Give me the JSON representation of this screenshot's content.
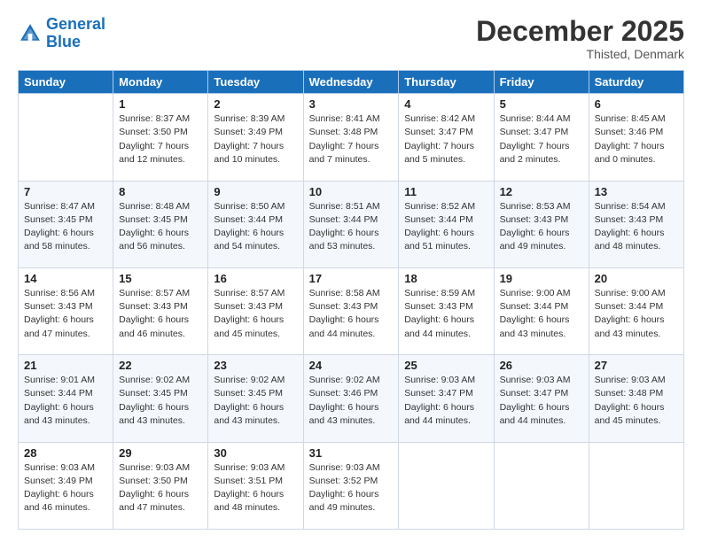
{
  "logo": {
    "line1": "General",
    "line2": "Blue"
  },
  "title": "December 2025",
  "subtitle": "Thisted, Denmark",
  "header_days": [
    "Sunday",
    "Monday",
    "Tuesday",
    "Wednesday",
    "Thursday",
    "Friday",
    "Saturday"
  ],
  "weeks": [
    [
      {
        "day": "",
        "info": ""
      },
      {
        "day": "1",
        "info": "Sunrise: 8:37 AM\nSunset: 3:50 PM\nDaylight: 7 hours\nand 12 minutes."
      },
      {
        "day": "2",
        "info": "Sunrise: 8:39 AM\nSunset: 3:49 PM\nDaylight: 7 hours\nand 10 minutes."
      },
      {
        "day": "3",
        "info": "Sunrise: 8:41 AM\nSunset: 3:48 PM\nDaylight: 7 hours\nand 7 minutes."
      },
      {
        "day": "4",
        "info": "Sunrise: 8:42 AM\nSunset: 3:47 PM\nDaylight: 7 hours\nand 5 minutes."
      },
      {
        "day": "5",
        "info": "Sunrise: 8:44 AM\nSunset: 3:47 PM\nDaylight: 7 hours\nand 2 minutes."
      },
      {
        "day": "6",
        "info": "Sunrise: 8:45 AM\nSunset: 3:46 PM\nDaylight: 7 hours\nand 0 minutes."
      }
    ],
    [
      {
        "day": "7",
        "info": "Sunrise: 8:47 AM\nSunset: 3:45 PM\nDaylight: 6 hours\nand 58 minutes."
      },
      {
        "day": "8",
        "info": "Sunrise: 8:48 AM\nSunset: 3:45 PM\nDaylight: 6 hours\nand 56 minutes."
      },
      {
        "day": "9",
        "info": "Sunrise: 8:50 AM\nSunset: 3:44 PM\nDaylight: 6 hours\nand 54 minutes."
      },
      {
        "day": "10",
        "info": "Sunrise: 8:51 AM\nSunset: 3:44 PM\nDaylight: 6 hours\nand 53 minutes."
      },
      {
        "day": "11",
        "info": "Sunrise: 8:52 AM\nSunset: 3:44 PM\nDaylight: 6 hours\nand 51 minutes."
      },
      {
        "day": "12",
        "info": "Sunrise: 8:53 AM\nSunset: 3:43 PM\nDaylight: 6 hours\nand 49 minutes."
      },
      {
        "day": "13",
        "info": "Sunrise: 8:54 AM\nSunset: 3:43 PM\nDaylight: 6 hours\nand 48 minutes."
      }
    ],
    [
      {
        "day": "14",
        "info": "Sunrise: 8:56 AM\nSunset: 3:43 PM\nDaylight: 6 hours\nand 47 minutes."
      },
      {
        "day": "15",
        "info": "Sunrise: 8:57 AM\nSunset: 3:43 PM\nDaylight: 6 hours\nand 46 minutes."
      },
      {
        "day": "16",
        "info": "Sunrise: 8:57 AM\nSunset: 3:43 PM\nDaylight: 6 hours\nand 45 minutes."
      },
      {
        "day": "17",
        "info": "Sunrise: 8:58 AM\nSunset: 3:43 PM\nDaylight: 6 hours\nand 44 minutes."
      },
      {
        "day": "18",
        "info": "Sunrise: 8:59 AM\nSunset: 3:43 PM\nDaylight: 6 hours\nand 44 minutes."
      },
      {
        "day": "19",
        "info": "Sunrise: 9:00 AM\nSunset: 3:44 PM\nDaylight: 6 hours\nand 43 minutes."
      },
      {
        "day": "20",
        "info": "Sunrise: 9:00 AM\nSunset: 3:44 PM\nDaylight: 6 hours\nand 43 minutes."
      }
    ],
    [
      {
        "day": "21",
        "info": "Sunrise: 9:01 AM\nSunset: 3:44 PM\nDaylight: 6 hours\nand 43 minutes."
      },
      {
        "day": "22",
        "info": "Sunrise: 9:02 AM\nSunset: 3:45 PM\nDaylight: 6 hours\nand 43 minutes."
      },
      {
        "day": "23",
        "info": "Sunrise: 9:02 AM\nSunset: 3:45 PM\nDaylight: 6 hours\nand 43 minutes."
      },
      {
        "day": "24",
        "info": "Sunrise: 9:02 AM\nSunset: 3:46 PM\nDaylight: 6 hours\nand 43 minutes."
      },
      {
        "day": "25",
        "info": "Sunrise: 9:03 AM\nSunset: 3:47 PM\nDaylight: 6 hours\nand 44 minutes."
      },
      {
        "day": "26",
        "info": "Sunrise: 9:03 AM\nSunset: 3:47 PM\nDaylight: 6 hours\nand 44 minutes."
      },
      {
        "day": "27",
        "info": "Sunrise: 9:03 AM\nSunset: 3:48 PM\nDaylight: 6 hours\nand 45 minutes."
      }
    ],
    [
      {
        "day": "28",
        "info": "Sunrise: 9:03 AM\nSunset: 3:49 PM\nDaylight: 6 hours\nand 46 minutes."
      },
      {
        "day": "29",
        "info": "Sunrise: 9:03 AM\nSunset: 3:50 PM\nDaylight: 6 hours\nand 47 minutes."
      },
      {
        "day": "30",
        "info": "Sunrise: 9:03 AM\nSunset: 3:51 PM\nDaylight: 6 hours\nand 48 minutes."
      },
      {
        "day": "31",
        "info": "Sunrise: 9:03 AM\nSunset: 3:52 PM\nDaylight: 6 hours\nand 49 minutes."
      },
      {
        "day": "",
        "info": ""
      },
      {
        "day": "",
        "info": ""
      },
      {
        "day": "",
        "info": ""
      }
    ]
  ]
}
